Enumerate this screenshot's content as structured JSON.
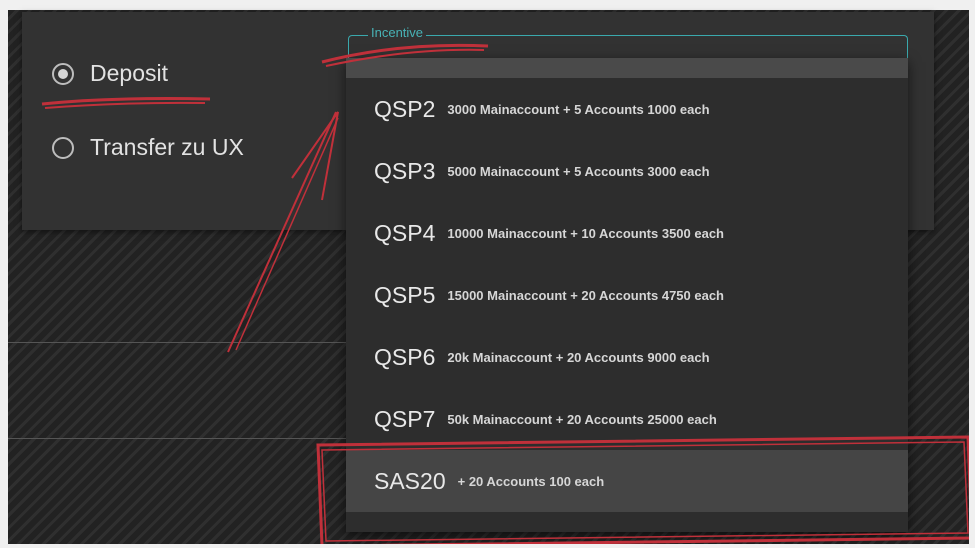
{
  "radio_group": {
    "options": [
      {
        "label": "Deposit",
        "selected": true
      },
      {
        "label": "Transfer zu UX",
        "selected": false
      }
    ]
  },
  "incentive": {
    "legend": "Incentive"
  },
  "dropdown": {
    "items": [
      {
        "code": "QSP2",
        "description": "3000 Mainaccount + 5 Accounts 1000 each"
      },
      {
        "code": "QSP3",
        "description": "5000 Mainaccount + 5 Accounts 3000 each"
      },
      {
        "code": "QSP4",
        "description": "10000 Mainaccount + 10 Accounts 3500 each"
      },
      {
        "code": "QSP5",
        "description": "15000 Mainaccount + 20 Accounts 4750 each"
      },
      {
        "code": "QSP6",
        "description": "20k Mainaccount + 20 Accounts 9000 each"
      },
      {
        "code": "QSP7",
        "description": "50k Mainaccount + 20 Accounts 25000 each"
      },
      {
        "code": "SAS20",
        "description": "+ 20 Accounts 100 each",
        "highlighted": true
      }
    ]
  },
  "colors": {
    "accent": "#48b3b6",
    "annotation": "#c0303a"
  }
}
